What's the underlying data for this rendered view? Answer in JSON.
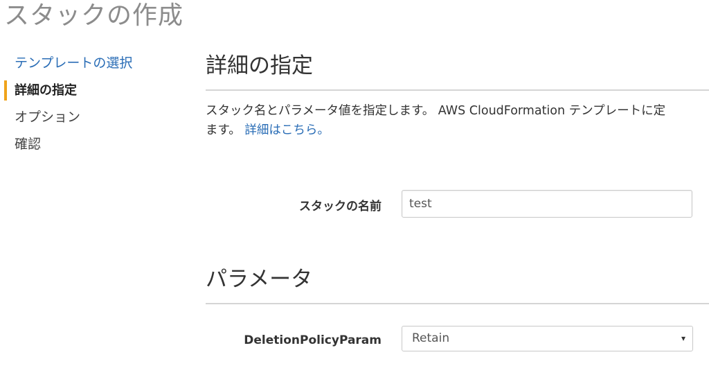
{
  "page": {
    "title": "スタックの作成"
  },
  "wizard_steps": [
    {
      "label": "テンプレートの選択",
      "state": "link"
    },
    {
      "label": "詳細の指定",
      "state": "active"
    },
    {
      "label": "オプション",
      "state": "pending"
    },
    {
      "label": "確認",
      "state": "pending"
    }
  ],
  "details_section": {
    "title": "詳細の指定",
    "description_line1": "スタック名とパラメータ値を指定します。 AWS CloudFormation テンプレートに定",
    "description_line2_prefix": "ます。 ",
    "learn_more_link": "詳細はこちら。"
  },
  "stack_name": {
    "label": "スタックの名前",
    "value": "test"
  },
  "parameters_section": {
    "title": "パラメータ"
  },
  "deletion_policy": {
    "label": "DeletionPolicyParam",
    "selected": "Retain"
  },
  "colors": {
    "accent_orange": "#f0a31a",
    "link_blue": "#2a6db6",
    "title_gray": "#8c8c8c"
  },
  "icons": {
    "select_arrow": "▾"
  }
}
